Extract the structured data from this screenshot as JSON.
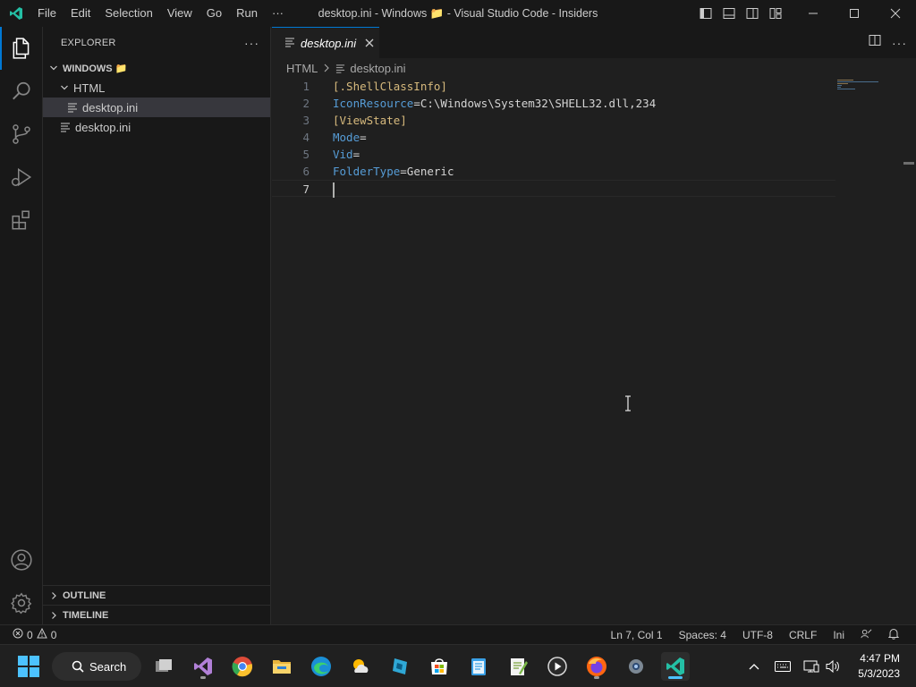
{
  "titlebar": {
    "menu": [
      "File",
      "Edit",
      "Selection",
      "View",
      "Go",
      "Run"
    ],
    "more": "···",
    "window_title": "desktop.ini - Windows 📁 - Visual Studio Code - Insiders"
  },
  "activity_bar": {
    "top_icons": [
      "files-icon",
      "search-icon",
      "source-control-icon",
      "run-debug-icon",
      "extensions-icon"
    ],
    "bottom_icons": [
      "account-icon",
      "settings-gear-icon"
    ]
  },
  "sidebar": {
    "header": "EXPLORER",
    "more": "···",
    "root": "WINDOWS 📁",
    "folder": "HTML",
    "nested_file": "desktop.ini",
    "root_file": "desktop.ini",
    "outline": "OUTLINE",
    "timeline": "TIMELINE"
  },
  "editor": {
    "tab_label": "desktop.ini",
    "breadcrumb": [
      "HTML",
      "desktop.ini"
    ],
    "more": "···",
    "lines": [
      {
        "num": "1",
        "parts": [
          {
            "t": "[.ShellClassInfo]",
            "c": "section"
          }
        ]
      },
      {
        "num": "2",
        "parts": [
          {
            "t": "IconResource",
            "c": "key"
          },
          {
            "t": "=C:\\Windows\\System32\\SHELL32.dll,234",
            "c": "val"
          }
        ]
      },
      {
        "num": "3",
        "parts": [
          {
            "t": "[ViewState]",
            "c": "section"
          }
        ]
      },
      {
        "num": "4",
        "parts": [
          {
            "t": "Mode",
            "c": "key"
          },
          {
            "t": "=",
            "c": "val"
          }
        ]
      },
      {
        "num": "5",
        "parts": [
          {
            "t": "Vid",
            "c": "key"
          },
          {
            "t": "=",
            "c": "val"
          }
        ]
      },
      {
        "num": "6",
        "parts": [
          {
            "t": "FolderType",
            "c": "key"
          },
          {
            "t": "=Generic",
            "c": "val"
          }
        ]
      },
      {
        "num": "7",
        "parts": [],
        "current": true
      }
    ]
  },
  "statusbar": {
    "errors": "0",
    "warnings": "0",
    "position": "Ln 7, Col 1",
    "spaces": "Spaces: 4",
    "encoding": "UTF-8",
    "eol": "CRLF",
    "language": "Ini"
  },
  "taskbar": {
    "search_label": "Search",
    "time": "4:47 PM",
    "date": "5/3/2023",
    "apps": [
      "task-view-icon",
      "visual-studio-icon",
      "chrome-icon",
      "file-explorer-icon",
      "edge-icon",
      "weather-icon",
      "app-icon",
      "store-icon",
      "notepad-icon",
      "notepad-plus-icon",
      "media-player-icon",
      "firefox-icon",
      "settings-icon",
      "vscode-insiders-icon"
    ]
  },
  "colors": {
    "accent": "#0078d4",
    "ini_section": "#d7ba7d",
    "ini_key": "#569cd6",
    "vscode_insiders": "#24bfa5"
  }
}
